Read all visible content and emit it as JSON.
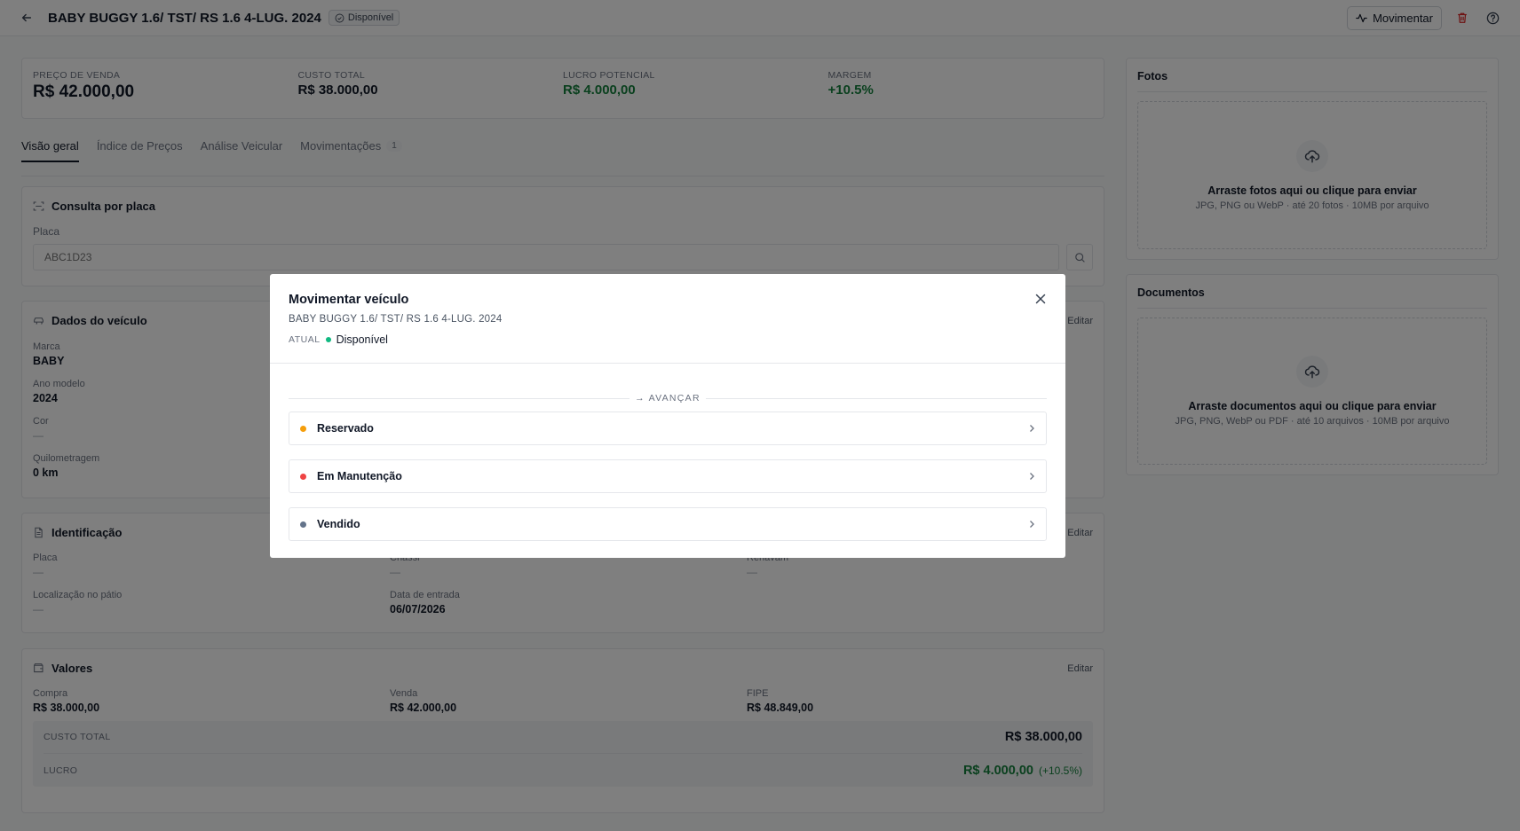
{
  "header": {
    "back_icon": "arrow-left-icon",
    "title": "BABY BUGGY 1.6/ TST/ RS 1.6 4-LUG. 2024",
    "status": "Disponível",
    "movimentar_label": "Movimentar",
    "delete_icon": "trash-icon",
    "help_icon": "help-circle-icon"
  },
  "kpis": [
    {
      "label": "Preço de venda",
      "value": "R$ 42.000,00"
    },
    {
      "label": "Custo total",
      "value": "R$ 38.000,00"
    },
    {
      "label": "Lucro potencial",
      "value": "R$ 4.000,00"
    },
    {
      "label": "Margem",
      "value": "+10.5%"
    }
  ],
  "tabs": [
    {
      "label": "Visão geral"
    },
    {
      "label": "Índice de Preços"
    },
    {
      "label": "Análise Veicular"
    },
    {
      "label": "Movimentações",
      "count": "1"
    }
  ],
  "consulta": {
    "title": "Consulta por placa",
    "field_label": "Placa",
    "placeholder": "ABC1D23"
  },
  "dados": {
    "title": "Dados do veículo",
    "edit": "Editar",
    "fields": [
      {
        "label": "Marca",
        "value": "BABY"
      },
      {
        "label": "Ano modelo",
        "value": "2024"
      },
      {
        "label": "Cor",
        "value": "—"
      },
      {
        "label": "Quilometragem",
        "value": "0 km"
      }
    ]
  },
  "identificacao": {
    "title": "Identificação",
    "edit": "Editar",
    "placa_label": "Placa",
    "placa_value": "—",
    "chassi_label": "Chassi",
    "chassi_value": "—",
    "renavam_label": "Renavam",
    "renavam_value": "—",
    "local_label": "Localização no pátio",
    "local_value": "—",
    "entrada_label": "Data de entrada",
    "entrada_value": "06/07/2026"
  },
  "valores": {
    "title": "Valores",
    "edit": "Editar",
    "compra_label": "Compra",
    "compra_value": "R$ 38.000,00",
    "venda_label": "Venda",
    "venda_value": "R$ 42.000,00",
    "fipe_label": "FIPE",
    "fipe_value": "R$ 48.849,00",
    "custo_label": "Custo total",
    "custo_value": "R$ 38.000,00",
    "lucro_label": "Lucro",
    "lucro_value": "R$ 4.000,00",
    "lucro_pct": "(+10.5%)"
  },
  "fotos": {
    "title": "Fotos",
    "drop_title": "Arraste fotos aqui ou clique para enviar",
    "drop_sub": "JPG, PNG ou WebP · até 20 fotos · 10MB por arquivo"
  },
  "documentos": {
    "title": "Documentos",
    "drop_title": "Arraste documentos aqui ou clique para enviar",
    "drop_sub": "JPG, PNG, WebP ou PDF · até 10 arquivos · 10MB por arquivo"
  },
  "modal": {
    "title": "Movimentar veículo",
    "subtitle": "BABY BUGGY 1.6/ TST/ RS 1.6 4-LUG. 2024",
    "current_label": "ATUAL",
    "current_value": "Disponível",
    "current_color": "#10b981",
    "divider_label": "→ AVANÇAR",
    "options": [
      {
        "label": "Reservado",
        "color": "#f59e0b"
      },
      {
        "label": "Em Manutenção",
        "color": "#ef4444"
      },
      {
        "label": "Vendido",
        "color": "#64748b"
      }
    ]
  },
  "colors": {
    "green": "#15803d",
    "danger": "#dc2626",
    "overlay": "rgba(0,0,0,0.5)"
  }
}
